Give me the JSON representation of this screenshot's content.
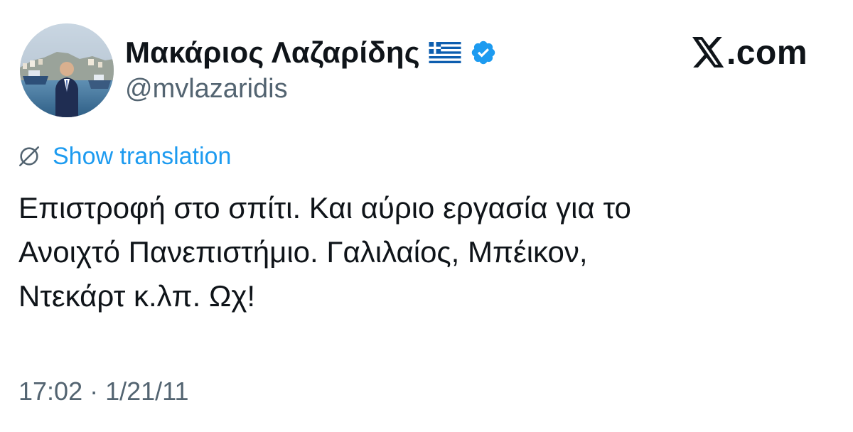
{
  "author": {
    "display_name": "Μακάριος Λαζαρίδης",
    "handle": "@mvlazaridis",
    "flag_icon": "greek-flag-icon",
    "verified_icon": "verified-badge-icon",
    "verified_color": "#1d9bf0"
  },
  "brand": {
    "logo_icon": "x-logo-icon",
    "domain_text": ".com"
  },
  "translation": {
    "icon": "globe-slash-icon",
    "label": "Show translation",
    "link_color": "#1d9bf0"
  },
  "tweet": {
    "lines": [
      "Επιστροφή στο σπίτι. Και αύριο εργασία για το",
      "Ανοιχτό Πανεπιστήμιο. Γαλιλαίος, Μπέικον,",
      "Ντεκάρτ κ.λπ. Ωχ!"
    ]
  },
  "meta": {
    "timestamp": "17:02 · 1/21/11"
  },
  "colors": {
    "text_primary": "#0f1419",
    "text_secondary": "#536471",
    "background": "#ffffff"
  }
}
